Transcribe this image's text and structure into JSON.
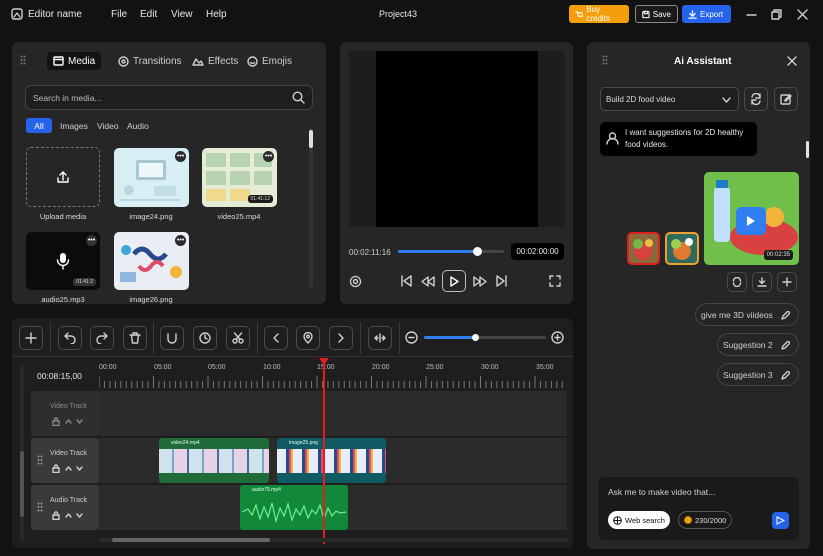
{
  "topbar": {
    "app_name": "Editor name",
    "menu": [
      "File",
      "Edit",
      "View",
      "Help"
    ],
    "project": "Project43",
    "buy_credits": "Buy credits",
    "save": "Save",
    "export": "Export"
  },
  "media": {
    "tabs": [
      "Media",
      "Transitions",
      "Effects",
      "Emojis"
    ],
    "search_placeholder": "Search in media...",
    "filters": [
      "All",
      "Images",
      "Video",
      "Audio"
    ],
    "items": [
      {
        "name": "Upload media"
      },
      {
        "name": "image24.png"
      },
      {
        "name": "video25.mp4",
        "duration": "01:41:12"
      },
      {
        "name": "audio25.mp3",
        "duration": "01:41:2"
      },
      {
        "name": "image26.png"
      }
    ]
  },
  "player": {
    "current_time": "00:02:11:16",
    "total_time": "00:02:00:00",
    "progress": 0.75
  },
  "timeline": {
    "timecode": "00:08:15,00",
    "ticks": [
      "00:00",
      "05:00",
      "05:00",
      "10:00",
      "15:00",
      "20:00",
      "25:00",
      "30:00",
      "35:00"
    ],
    "zoom": 0.42,
    "tracks": [
      {
        "name": "Video Track"
      },
      {
        "name": "Video Track"
      },
      {
        "name": "Audio Track"
      }
    ],
    "clips": {
      "video1": "video24.mp4",
      "video2": "image25.png",
      "audio": "audio75.mp4"
    }
  },
  "assistant": {
    "title": "Ai Assistant",
    "mode": "Build 2D food video",
    "user_message": "I want suggestions for 2D healthy food videos.",
    "video_duration": "00:02:35",
    "suggestions": [
      "give me 3D viideos",
      "Suggestion 2",
      "Suggestion 3"
    ],
    "input_placeholder": "Ask me to make video that...",
    "web_search": "Web search",
    "credits": "230/2000"
  },
  "colors": {
    "accent": "#2563eb",
    "buy": "#f59e0b",
    "video_clip": "#1f6b3a",
    "image_clip": "#0f5a63",
    "audio_clip": "#12893a",
    "playhead": "#e02020"
  }
}
